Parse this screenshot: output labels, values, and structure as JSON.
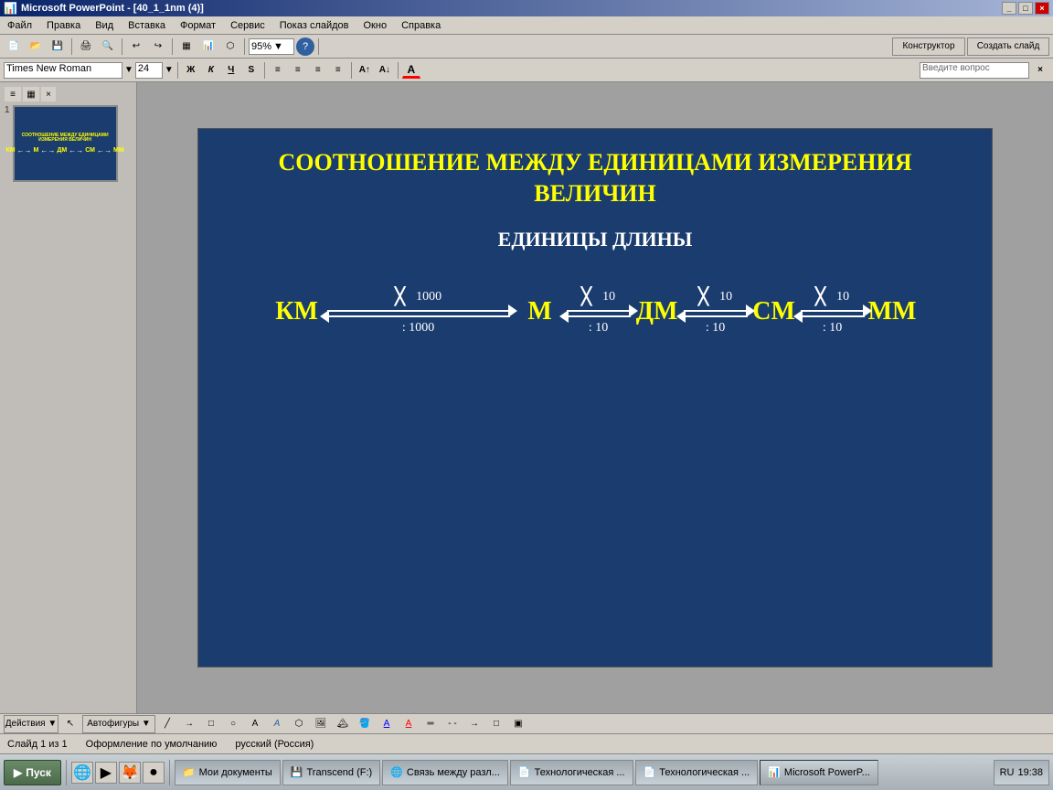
{
  "window": {
    "title": "Microsoft PowerPoint - [40_1_1nm (4)]",
    "controls": [
      "_",
      "□",
      "×"
    ]
  },
  "menu": {
    "items": [
      "Файл",
      "Правка",
      "Вид",
      "Вставка",
      "Формат",
      "Сервис",
      "Показ слайдов",
      "Окно",
      "Справка"
    ]
  },
  "toolbar": {
    "zoom": "95%",
    "ask_placeholder": "Введите вопрос"
  },
  "formatting": {
    "font_name": "Times New Roman",
    "font_size": "24",
    "bold": "Ж",
    "italic": "К",
    "underline": "Ч",
    "strikethrough": "S"
  },
  "slide": {
    "title_line1": "СООТНОШЕНИЕ МЕЖДУ ЕДИНИЦАМИ ИЗМЕРЕНИЯ",
    "title_line2": "ВЕЛИЧИН",
    "subtitle": "ЕДИНИЦЫ ДЛИНЫ",
    "units": {
      "km": "КМ",
      "m": "М",
      "dm": "ДМ",
      "cm": "СМ",
      "mm": "ММ"
    },
    "arrows": {
      "km_m": {
        "multiply": "× 1000",
        "divide": ": 1000",
        "width": "long"
      },
      "m_dm": {
        "multiply": "× 10",
        "divide": ": 10",
        "width": "short"
      },
      "dm_cm": {
        "multiply": "× 10",
        "divide": ": 10",
        "width": "short"
      },
      "cm_mm": {
        "multiply": "× 10",
        "divide": ": 10",
        "width": "short"
      }
    }
  },
  "status": {
    "slide_info": "Слайд 1 из 1",
    "design": "Оформление по умолчанию",
    "language": "русский (Россия)"
  },
  "taskbar": {
    "start_label": "Пуск",
    "time": "19:38",
    "apps": [
      {
        "label": "Мои документы",
        "active": false
      },
      {
        "label": "Transcend (F:)",
        "active": false
      },
      {
        "label": "Связь между разл...",
        "active": false
      },
      {
        "label": "Технологическая ...",
        "active": false
      },
      {
        "label": "Технологическая ...",
        "active": false
      },
      {
        "label": "Microsoft PowerP...",
        "active": true
      }
    ]
  }
}
